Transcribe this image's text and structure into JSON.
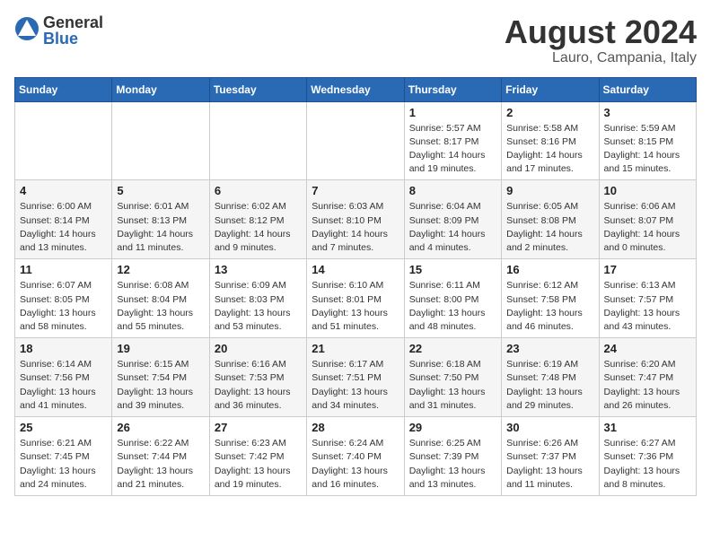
{
  "header": {
    "logo_general": "General",
    "logo_blue": "Blue",
    "title": "August 2024",
    "subtitle": "Lauro, Campania, Italy"
  },
  "days_of_week": [
    "Sunday",
    "Monday",
    "Tuesday",
    "Wednesday",
    "Thursday",
    "Friday",
    "Saturday"
  ],
  "weeks": [
    [
      {
        "day": "",
        "info": ""
      },
      {
        "day": "",
        "info": ""
      },
      {
        "day": "",
        "info": ""
      },
      {
        "day": "",
        "info": ""
      },
      {
        "day": "1",
        "info": "Sunrise: 5:57 AM\nSunset: 8:17 PM\nDaylight: 14 hours\nand 19 minutes."
      },
      {
        "day": "2",
        "info": "Sunrise: 5:58 AM\nSunset: 8:16 PM\nDaylight: 14 hours\nand 17 minutes."
      },
      {
        "day": "3",
        "info": "Sunrise: 5:59 AM\nSunset: 8:15 PM\nDaylight: 14 hours\nand 15 minutes."
      }
    ],
    [
      {
        "day": "4",
        "info": "Sunrise: 6:00 AM\nSunset: 8:14 PM\nDaylight: 14 hours\nand 13 minutes."
      },
      {
        "day": "5",
        "info": "Sunrise: 6:01 AM\nSunset: 8:13 PM\nDaylight: 14 hours\nand 11 minutes."
      },
      {
        "day": "6",
        "info": "Sunrise: 6:02 AM\nSunset: 8:12 PM\nDaylight: 14 hours\nand 9 minutes."
      },
      {
        "day": "7",
        "info": "Sunrise: 6:03 AM\nSunset: 8:10 PM\nDaylight: 14 hours\nand 7 minutes."
      },
      {
        "day": "8",
        "info": "Sunrise: 6:04 AM\nSunset: 8:09 PM\nDaylight: 14 hours\nand 4 minutes."
      },
      {
        "day": "9",
        "info": "Sunrise: 6:05 AM\nSunset: 8:08 PM\nDaylight: 14 hours\nand 2 minutes."
      },
      {
        "day": "10",
        "info": "Sunrise: 6:06 AM\nSunset: 8:07 PM\nDaylight: 14 hours\nand 0 minutes."
      }
    ],
    [
      {
        "day": "11",
        "info": "Sunrise: 6:07 AM\nSunset: 8:05 PM\nDaylight: 13 hours\nand 58 minutes."
      },
      {
        "day": "12",
        "info": "Sunrise: 6:08 AM\nSunset: 8:04 PM\nDaylight: 13 hours\nand 55 minutes."
      },
      {
        "day": "13",
        "info": "Sunrise: 6:09 AM\nSunset: 8:03 PM\nDaylight: 13 hours\nand 53 minutes."
      },
      {
        "day": "14",
        "info": "Sunrise: 6:10 AM\nSunset: 8:01 PM\nDaylight: 13 hours\nand 51 minutes."
      },
      {
        "day": "15",
        "info": "Sunrise: 6:11 AM\nSunset: 8:00 PM\nDaylight: 13 hours\nand 48 minutes."
      },
      {
        "day": "16",
        "info": "Sunrise: 6:12 AM\nSunset: 7:58 PM\nDaylight: 13 hours\nand 46 minutes."
      },
      {
        "day": "17",
        "info": "Sunrise: 6:13 AM\nSunset: 7:57 PM\nDaylight: 13 hours\nand 43 minutes."
      }
    ],
    [
      {
        "day": "18",
        "info": "Sunrise: 6:14 AM\nSunset: 7:56 PM\nDaylight: 13 hours\nand 41 minutes."
      },
      {
        "day": "19",
        "info": "Sunrise: 6:15 AM\nSunset: 7:54 PM\nDaylight: 13 hours\nand 39 minutes."
      },
      {
        "day": "20",
        "info": "Sunrise: 6:16 AM\nSunset: 7:53 PM\nDaylight: 13 hours\nand 36 minutes."
      },
      {
        "day": "21",
        "info": "Sunrise: 6:17 AM\nSunset: 7:51 PM\nDaylight: 13 hours\nand 34 minutes."
      },
      {
        "day": "22",
        "info": "Sunrise: 6:18 AM\nSunset: 7:50 PM\nDaylight: 13 hours\nand 31 minutes."
      },
      {
        "day": "23",
        "info": "Sunrise: 6:19 AM\nSunset: 7:48 PM\nDaylight: 13 hours\nand 29 minutes."
      },
      {
        "day": "24",
        "info": "Sunrise: 6:20 AM\nSunset: 7:47 PM\nDaylight: 13 hours\nand 26 minutes."
      }
    ],
    [
      {
        "day": "25",
        "info": "Sunrise: 6:21 AM\nSunset: 7:45 PM\nDaylight: 13 hours\nand 24 minutes."
      },
      {
        "day": "26",
        "info": "Sunrise: 6:22 AM\nSunset: 7:44 PM\nDaylight: 13 hours\nand 21 minutes."
      },
      {
        "day": "27",
        "info": "Sunrise: 6:23 AM\nSunset: 7:42 PM\nDaylight: 13 hours\nand 19 minutes."
      },
      {
        "day": "28",
        "info": "Sunrise: 6:24 AM\nSunset: 7:40 PM\nDaylight: 13 hours\nand 16 minutes."
      },
      {
        "day": "29",
        "info": "Sunrise: 6:25 AM\nSunset: 7:39 PM\nDaylight: 13 hours\nand 13 minutes."
      },
      {
        "day": "30",
        "info": "Sunrise: 6:26 AM\nSunset: 7:37 PM\nDaylight: 13 hours\nand 11 minutes."
      },
      {
        "day": "31",
        "info": "Sunrise: 6:27 AM\nSunset: 7:36 PM\nDaylight: 13 hours\nand 8 minutes."
      }
    ]
  ]
}
